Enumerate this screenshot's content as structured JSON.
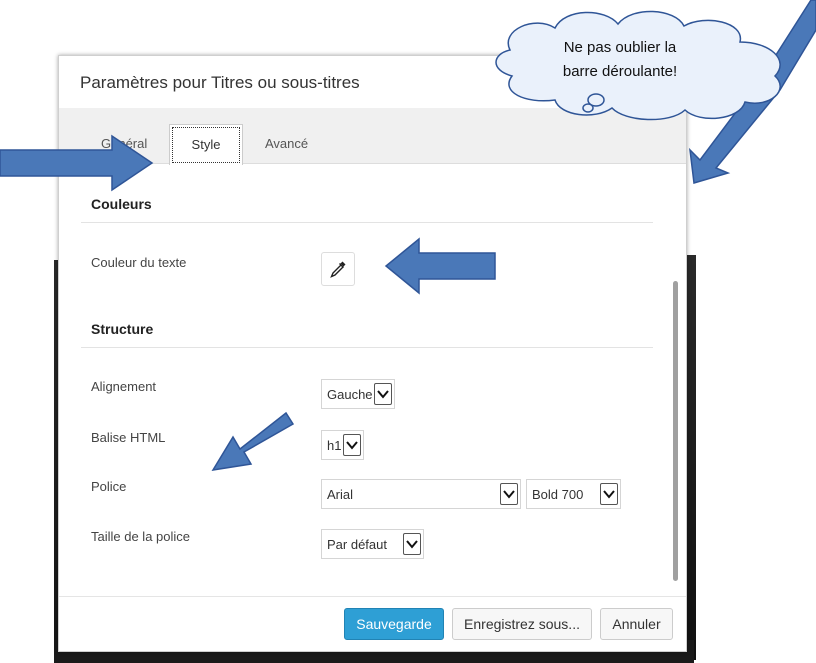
{
  "dialog": {
    "title": "Paramètres pour Titres ou sous-titres",
    "tabs": [
      {
        "label": "Général"
      },
      {
        "label": "Style",
        "active": true
      },
      {
        "label": "Avancé"
      }
    ]
  },
  "sections": {
    "colors": {
      "heading": "Couleurs",
      "text_color_label": "Couleur du texte",
      "picker_icon": "eyedropper-icon"
    },
    "structure": {
      "heading": "Structure",
      "alignment": {
        "label": "Alignement",
        "value": "Gauche"
      },
      "html_tag": {
        "label": "Balise HTML",
        "value": "h1"
      },
      "font": {
        "label": "Police",
        "family": "Arial",
        "weight": "Bold 700"
      },
      "font_size": {
        "label": "Taille de la police",
        "value": "Par défaut"
      }
    }
  },
  "footer": {
    "save": "Sauvegarde",
    "save_as": "Enregistrez sous...",
    "cancel": "Annuler"
  },
  "annotation": {
    "line1": "Ne pas oublier  la",
    "line2": "barre déroulante!",
    "arrow_color": "#4a78b8",
    "bubble_color": "#eaf1fb"
  },
  "colors": {
    "primary_button": "#2e9fd5",
    "tab_bar": "#f0f0f0"
  }
}
